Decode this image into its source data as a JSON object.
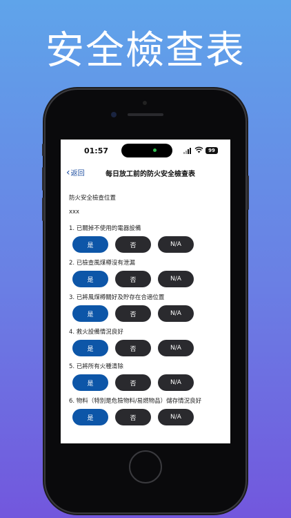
{
  "headline": "安全檢查表",
  "status_bar": {
    "time": "01:57",
    "battery": "99"
  },
  "nav": {
    "back_label": "返回",
    "title": "每日放工前的防火安全檢查表"
  },
  "form": {
    "location_label": "防火安全檢查位置",
    "location_value": "xxx",
    "options": {
      "yes": "是",
      "no": "否",
      "na": "N/A"
    },
    "questions": [
      "1. 已關掉不使用的電器設備",
      "2. 已檢查風煤樽沒有泄漏",
      "3. 已將風煤樽關好及貯存在合適位置",
      "4. 救火設備情況良好",
      "5. 已將所有火種清除",
      "6. 物料（特別是危險物料/易燃物品）儲存情況良好"
    ]
  },
  "colors": {
    "accent": "#0d56a8",
    "button_dark": "#2a2a2e",
    "back_link": "#1f4fa0"
  }
}
